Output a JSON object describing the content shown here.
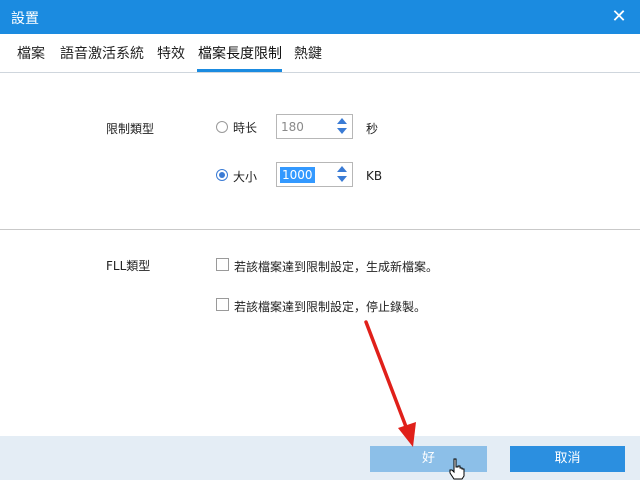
{
  "window": {
    "title": "設置",
    "close_glyph": "✕"
  },
  "tabs": [
    {
      "label": "檔案"
    },
    {
      "label": "語音激活系統"
    },
    {
      "label": "特效"
    },
    {
      "label": "檔案長度限制",
      "active": true
    },
    {
      "label": "熱鍵"
    }
  ],
  "limit_type": {
    "label": "限制類型",
    "options": [
      {
        "label": "時长",
        "value": "180",
        "unit": "秒",
        "selected": false
      },
      {
        "label": "大小",
        "value": "1000",
        "unit": "KB",
        "selected": true
      }
    ]
  },
  "fll_type": {
    "label": "FLL類型",
    "options": [
      {
        "label": "若該檔案達到限制設定，生成新檔案。",
        "checked": false
      },
      {
        "label": "若該檔案達到限制設定，停止錄製。",
        "checked": false
      }
    ]
  },
  "buttons": {
    "ok": "好",
    "cancel": "取消"
  },
  "icons": {
    "close": "close-icon",
    "spin_up": "triangle-up-icon",
    "spin_down": "triangle-down-icon",
    "cursor": "hand-pointer-icon",
    "annotation": "red-arrow-annotation"
  },
  "colors": {
    "accent": "#1b8be0",
    "ok_button": "#8cbfe8",
    "cancel_button": "#2b8fe0",
    "footer": "#e4edf5",
    "annotation": "#e0201a"
  }
}
